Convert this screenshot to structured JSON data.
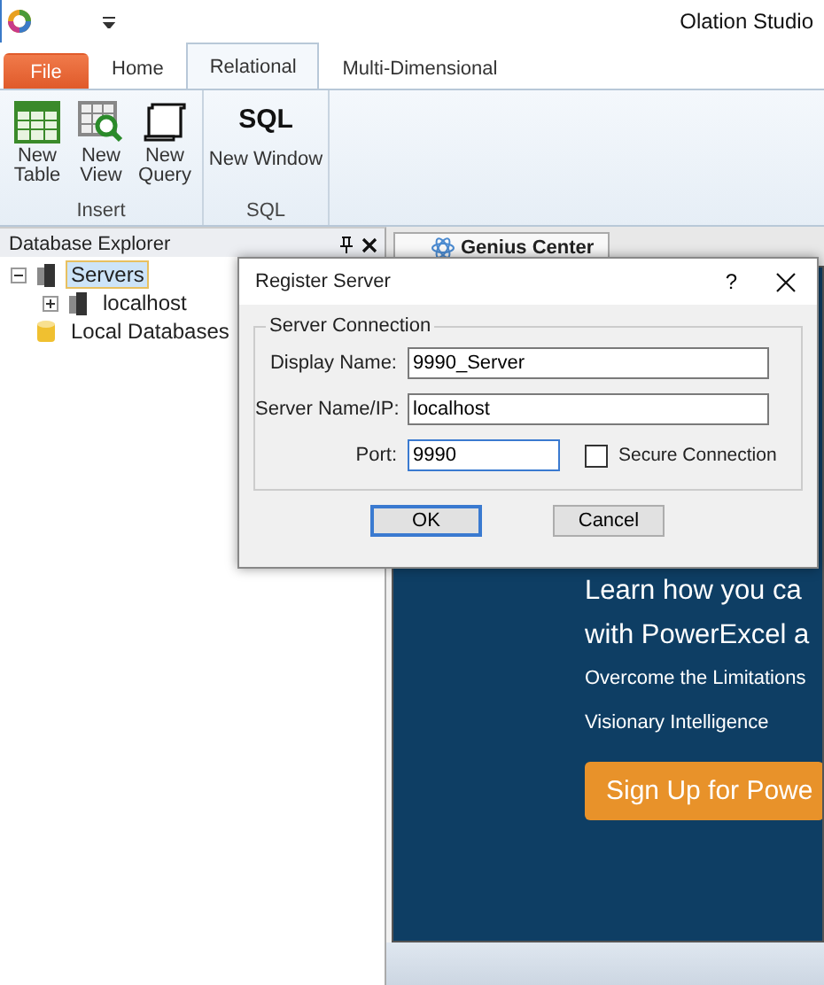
{
  "app": {
    "title": "Olation Studio"
  },
  "ribbon_tabs": [
    {
      "label": "File",
      "kind": "file",
      "selected": false
    },
    {
      "label": "Home",
      "kind": "tab",
      "selected": false
    },
    {
      "label": "Relational",
      "kind": "tab",
      "selected": true
    },
    {
      "label": "Multi-Dimensional",
      "kind": "tab",
      "selected": false
    }
  ],
  "ribbon_groups": [
    {
      "label": "Insert",
      "buttons": [
        {
          "label": "New Table",
          "kind": "table"
        },
        {
          "label": "New View",
          "kind": "view"
        },
        {
          "label": "New Query",
          "kind": "query"
        }
      ]
    },
    {
      "label": "SQL",
      "buttons": [
        {
          "label": "New Window",
          "kind": "sql",
          "icon_text": "SQL"
        }
      ]
    }
  ],
  "explorer": {
    "title": "Database Explorer",
    "tree": [
      {
        "label": "Servers",
        "kind": "server",
        "selected": true,
        "expanded": true,
        "children": [
          {
            "label": "localhost",
            "kind": "server",
            "selected": false,
            "expanded": false
          }
        ]
      },
      {
        "label": "Local Databases",
        "kind": "database",
        "selected": false
      }
    ]
  },
  "document_tab": {
    "label": "Genius Center"
  },
  "banner": {
    "headline_lines": [
      "Learn how you ca",
      "with PowerExcel a"
    ],
    "lines": [
      "Overcome the Limitations",
      "Visionary Intelligence"
    ],
    "button": "Sign Up for Powe"
  },
  "dialog": {
    "title": "Register Server",
    "help": "?",
    "group": "Server Connection",
    "fields": [
      {
        "label": "Display Name:",
        "value": "9990_Server",
        "focused": false
      },
      {
        "label": "Server Name/IP:",
        "value": "localhost",
        "focused": false
      },
      {
        "label": "Port:",
        "value": "9990",
        "focused": true
      }
    ],
    "checkbox": {
      "label": "Secure Connection",
      "checked": false
    },
    "buttons": [
      {
        "label": "OK",
        "default": true
      },
      {
        "label": "Cancel",
        "default": false
      }
    ]
  }
}
